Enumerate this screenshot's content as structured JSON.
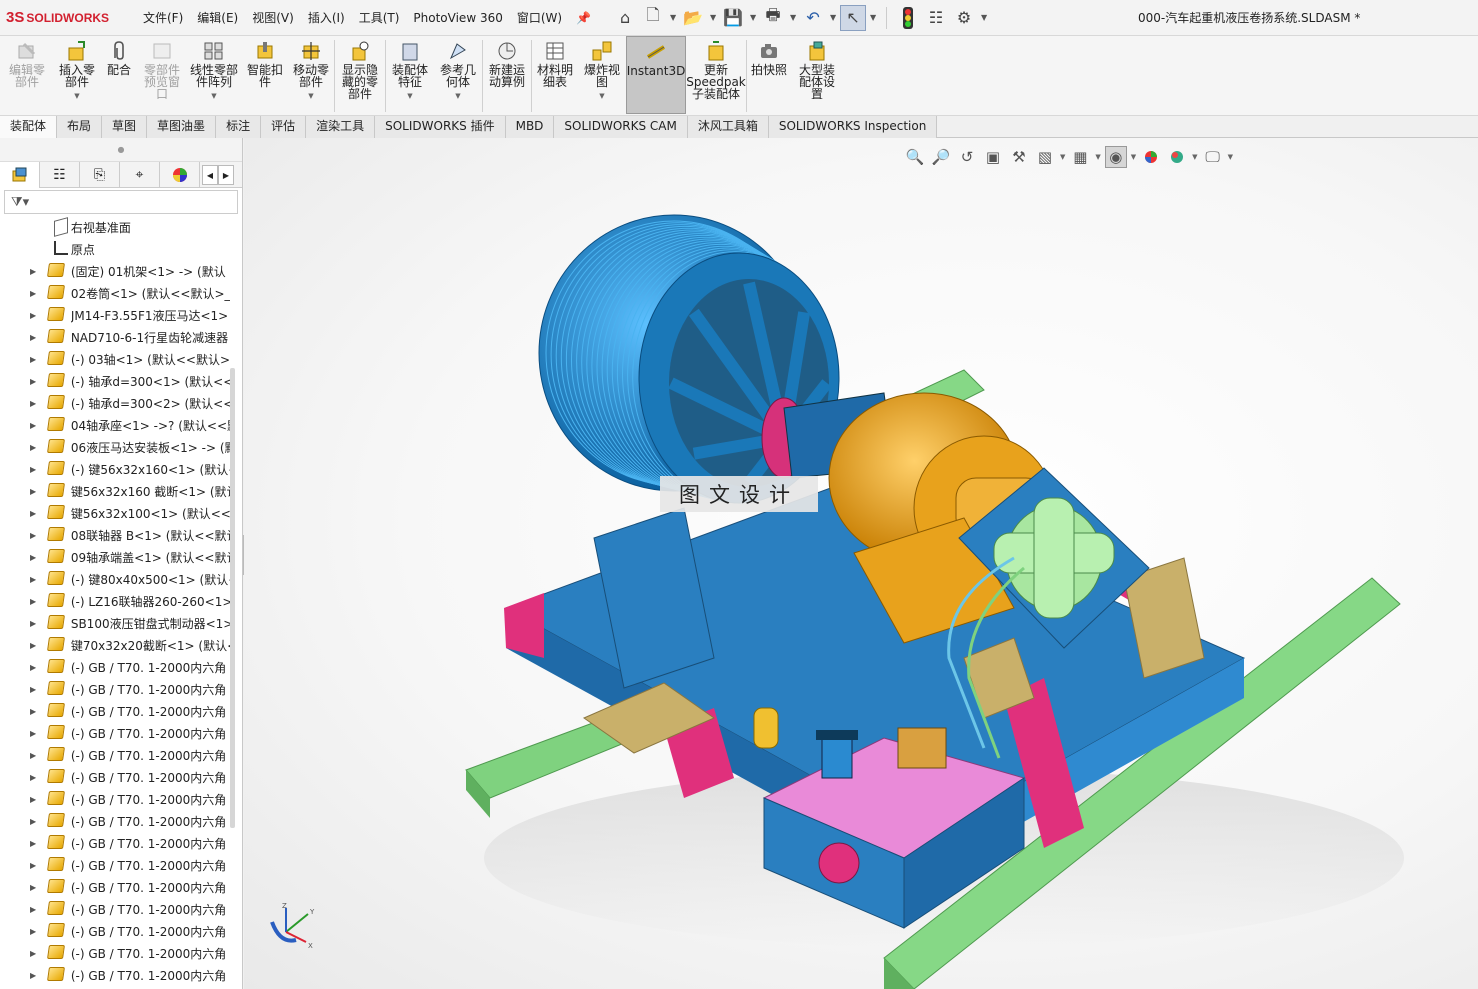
{
  "app": {
    "logo_mark": "3S",
    "logo_text": "SOLIDWORKS",
    "document_title": "000-汽车起重机液压卷扬系统.SLDASM *"
  },
  "menu": [
    "文件(F)",
    "编辑(E)",
    "视图(V)",
    "插入(I)",
    "工具(T)",
    "PhotoView 360",
    "窗口(W)"
  ],
  "quick_access": {
    "icons": [
      "home-icon",
      "new-document-icon",
      "open-icon",
      "save-icon",
      "print-icon",
      "undo-icon",
      "select-pointer-icon",
      "traffic-light-icon",
      "file-properties-icon",
      "options-gear-icon"
    ]
  },
  "ribbon": {
    "edit_component": "编辑零\n部件",
    "insert_component": "插入零\n部件",
    "mate": "配合",
    "component_preview": "零部件\n预览窗\n口",
    "linear_pattern": "线性零部\n件阵列",
    "smart_fasteners": "智能扣\n件",
    "move_component": "移动零\n部件",
    "show_hidden": "显示隐\n藏的零\n部件",
    "assembly_features": "装配体\n特征",
    "reference_geometry": "参考几\n何体",
    "new_motion_study": "新建运\n动算例",
    "bill_of_materials": "材料明\n细表",
    "exploded_view": "爆炸视\n图",
    "instant3d": "Instant3D",
    "update_speedpak": "更新\nSpeedpak\n子装配体",
    "take_snapshot": "拍快照",
    "large_assembly": "大型装\n配体设\n置"
  },
  "tabs": [
    "装配体",
    "布局",
    "草图",
    "草图油墨",
    "标注",
    "评估",
    "渲染工具",
    "SOLIDWORKS 插件",
    "MBD",
    "SOLIDWORKS CAM",
    "沐风工具箱",
    "SOLIDWORKS Inspection"
  ],
  "active_tab": "装配体",
  "feature_tree": {
    "items": [
      {
        "type": "plane",
        "label": "右视基准面"
      },
      {
        "type": "origin",
        "label": "原点"
      },
      {
        "type": "part",
        "label": "(固定) 01机架<1> -> (默认"
      },
      {
        "type": "part",
        "label": "02卷筒<1> (默认<<默认>_"
      },
      {
        "type": "part",
        "label": "JM14-F3.55F1液压马达<1>"
      },
      {
        "type": "part",
        "label": "NAD710-6-1行星齿轮减速器"
      },
      {
        "type": "part",
        "label": "(-) 03轴<1> (默认<<默认>"
      },
      {
        "type": "part",
        "label": "(-) 轴承d=300<1> (默认<<"
      },
      {
        "type": "part",
        "label": "(-) 轴承d=300<2> (默认<<"
      },
      {
        "type": "part",
        "label": "04轴承座<1> ->? (默认<<默"
      },
      {
        "type": "part",
        "label": "06液压马达安装板<1> -> (默"
      },
      {
        "type": "part",
        "label": "(-) 键56x32x160<1> (默认<"
      },
      {
        "type": "part",
        "label": "键56x32x160 截断<1> (默认"
      },
      {
        "type": "part",
        "label": "键56x32x100<1> (默认<<默"
      },
      {
        "type": "part",
        "label": "08联轴器 B<1> (默认<<默认"
      },
      {
        "type": "part",
        "label": "09轴承端盖<1> (默认<<默认"
      },
      {
        "type": "part",
        "label": "(-) 键80x40x500<1> (默认<"
      },
      {
        "type": "part",
        "label": "(-) LZ16联轴器260-260<1>"
      },
      {
        "type": "part",
        "label": "SB100液压钳盘式制动器<1>"
      },
      {
        "type": "part",
        "label": "键70x32x20截断<1> (默认<"
      },
      {
        "type": "part",
        "label": "(-) GB / T70.  1-2000内六角"
      },
      {
        "type": "part",
        "label": "(-) GB / T70.  1-2000内六角"
      },
      {
        "type": "part",
        "label": "(-) GB / T70.  1-2000内六角"
      },
      {
        "type": "part",
        "label": "(-) GB / T70.  1-2000内六角"
      },
      {
        "type": "part",
        "label": "(-) GB / T70.  1-2000内六角"
      },
      {
        "type": "part",
        "label": "(-) GB / T70.  1-2000内六角"
      },
      {
        "type": "part",
        "label": "(-) GB / T70.  1-2000内六角"
      },
      {
        "type": "part",
        "label": "(-) GB / T70.  1-2000内六角"
      },
      {
        "type": "part",
        "label": "(-) GB / T70.  1-2000内六角"
      },
      {
        "type": "part",
        "label": "(-) GB / T70.  1-2000内六角"
      },
      {
        "type": "part",
        "label": "(-) GB / T70.  1-2000内六角"
      },
      {
        "type": "part",
        "label": "(-) GB / T70.  1-2000内六角"
      },
      {
        "type": "part",
        "label": "(-) GB / T70.  1-2000内六角"
      },
      {
        "type": "part",
        "label": "(-) GB / T70.  1-2000内六角"
      },
      {
        "type": "part",
        "label": "(-) GB / T70.  1-2000内六角"
      }
    ]
  },
  "viewport": {
    "watermark": "图文设计",
    "triad_labels": {
      "x": "X",
      "y": "Y",
      "z": "Z"
    }
  },
  "colors": {
    "brand_red": "#d2202f",
    "drum_blue": "#1e88c8",
    "frame_blue": "#2a7fc0",
    "gearbox_orange": "#e8a21c",
    "rail_green": "#7fd27f",
    "support_magenta": "#e0307c",
    "tan_block": "#c9b06a",
    "tank_pink": "#e98ad8",
    "motor_green": "#a8e6a0"
  }
}
